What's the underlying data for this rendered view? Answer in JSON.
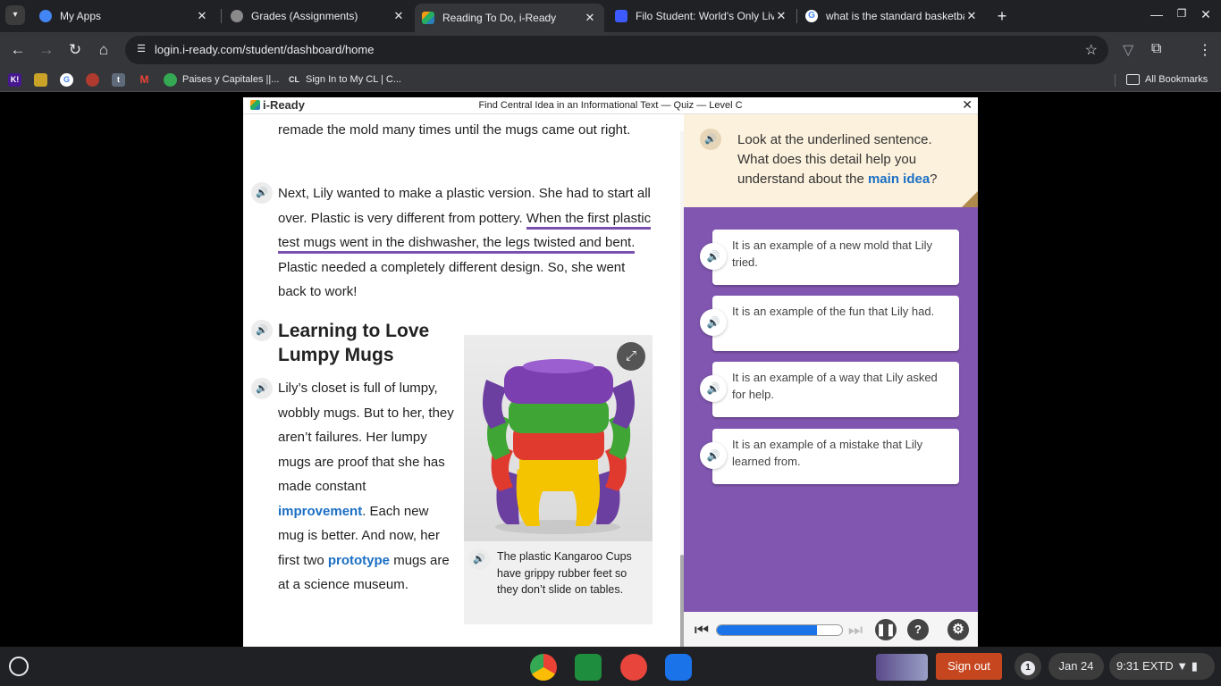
{
  "browser": {
    "tabs": [
      {
        "title": "My Apps",
        "favicon_color": "#4285f4",
        "active": false
      },
      {
        "title": "Grades (Assignments)",
        "favicon_color": "#8a8a8a",
        "active": false
      },
      {
        "title": "Reading To Do, i-Ready",
        "favicon_color": "#f39c12",
        "active": true
      },
      {
        "title": "Filo Student: World's Only Live I",
        "favicon_color": "#3d5afe",
        "active": false
      },
      {
        "title": "what is the standard basketbal",
        "favicon_color": "#ffffff",
        "active": false
      }
    ],
    "tab_close": "✕",
    "new_tab": "+",
    "url": "login.i-ready.com/student/dashboard/home",
    "bookmarks": [
      {
        "label": "",
        "icon_text": "K!",
        "color": "#46178f"
      },
      {
        "label": "",
        "icon_text": "",
        "color": "#c9a227"
      },
      {
        "label": "",
        "icon_text": "G",
        "color": "#ffffff"
      },
      {
        "label": "",
        "icon_text": "",
        "color": "#b03a2e"
      },
      {
        "label": "",
        "icon_text": "t",
        "color": "#5f6b7a"
      },
      {
        "label": "",
        "icon_text": "M",
        "color": "#ea4335"
      },
      {
        "label": "Paises y Capitales ||...",
        "icon_text": "",
        "color": "#34a853"
      },
      {
        "label": "Sign In to My CL | C...",
        "icon_text": "CL",
        "color": "#555555"
      }
    ],
    "all_bookmarks": "All Bookmarks"
  },
  "app": {
    "logo": "i-Ready",
    "lesson_title": "Find Central Idea in an Informational Text — Quiz — Level C",
    "close": "✕"
  },
  "reading": {
    "para1": "remade the mold many times until the mugs came out right.",
    "para2_before": "Next, Lily wanted to make a plastic version. She had to start all over. Plastic is very different from pottery.",
    "para2_underlined": "When the first plastic test mugs went in the dishwasher, the legs twisted and bent.",
    "para2_after": "Plastic needed a completely different design. So, she went back to work!",
    "heading": "Learning to Love Lumpy Mugs",
    "para3_a": "Lily’s closet is full of lumpy, wobbly mugs. But to her, they aren’t failures. Her lumpy mugs are proof that she has made constant",
    "para3_vocab1": "improvement",
    "para3_b": ". Each new mug is better. And now, her first two",
    "para3_vocab2": "prototype",
    "para3_c": "mugs are at a science museum.",
    "caption": "The plastic Kangaroo Cups have grippy rubber feet so they don’t slide on tables."
  },
  "question": {
    "prompt_before": "Look at the underlined sentence. What does this detail help you understand about the",
    "prompt_link": "main idea",
    "prompt_after": "?",
    "choices": [
      "It is an example of a new mold that Lily tried.",
      "It is an example of the fun that Lily had.",
      "It is an example of a way that Lily asked for help.",
      "It is an example of a mistake that Lily learned from."
    ]
  },
  "controls": {
    "progress": 0.8,
    "help": "?"
  },
  "taskbar": {
    "sign_out": "Sign out",
    "notification_count": "1",
    "date": "Jan 24",
    "time": "9:31",
    "status": "EXTD"
  },
  "colors": {
    "accent_purple": "#8056b0",
    "prompt_bg": "#fcf1dc",
    "vocab_blue": "#1a6fc4",
    "sign_out_bg": "#c6471f"
  }
}
